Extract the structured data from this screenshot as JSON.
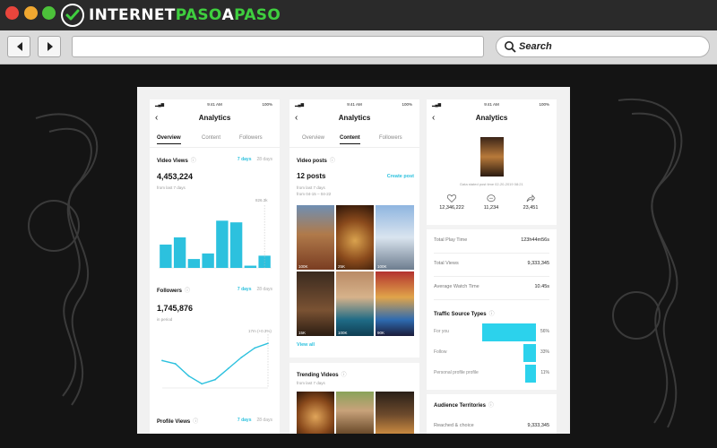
{
  "browser": {
    "brand_part1": "INTERNET",
    "brand_part2": "PASO",
    "brand_part3": "A",
    "brand_part4": "PASO",
    "search_placeholder": "Search",
    "colors": {
      "brand_green": "#3fcf3f",
      "chrome": "#2a2a2a",
      "accent_cyan": "#2cc1de"
    }
  },
  "status_bar": {
    "time": "9:41 AM",
    "battery": "100%"
  },
  "panel1": {
    "title": "Analytics",
    "tabs": [
      "Overview",
      "Content",
      "Followers"
    ],
    "video_views": {
      "label": "Video Views",
      "range_selected": "7 days",
      "range_other": "28 days",
      "total": "4,453,224",
      "subtext": "from last 7 days",
      "peak_label": "826.3k"
    },
    "followers": {
      "label": "Followers",
      "range_selected": "7 days",
      "range_other": "28 days",
      "total": "1,745,876",
      "subtext": "in period",
      "peak_label": "17m (+0.3%)"
    },
    "profile_views": {
      "label": "Profile Views",
      "range_selected": "7 days",
      "range_other": "28 days"
    }
  },
  "panel2": {
    "title": "Analytics",
    "tabs": [
      "Overview",
      "Content",
      "Followers"
    ],
    "video_posts_label": "Video posts",
    "posts_count": "12 posts",
    "create_post": "Create post",
    "posts_sub": "from last 7 days",
    "posts_range": "from 04-15 – 04-22",
    "thumb_views": [
      "100K",
      "25K",
      "100K",
      "15K",
      "100K",
      "90K"
    ],
    "view_all": "View all",
    "trending_label": "Trending Videos",
    "trending_sub": "from last 7 days"
  },
  "panel3": {
    "title": "Analytics",
    "posted_text": "Data stated post time 02-20-2019 08:21",
    "stats": [
      {
        "icon": "heart-icon",
        "value": "12,346,222"
      },
      {
        "icon": "comment-icon",
        "value": "11,234"
      },
      {
        "icon": "share-icon",
        "value": "23,451"
      }
    ],
    "metrics": [
      {
        "key": "Total Play Time",
        "value": "123h44m56s"
      },
      {
        "key": "Total Views",
        "value": "9,333,345"
      },
      {
        "key": "Average Watch Time",
        "value": "10.45s"
      }
    ],
    "traffic_label": "Traffic Source Types",
    "traffic": [
      {
        "key": "For you",
        "pct": "56%"
      },
      {
        "key": "Follow",
        "pct": "33%"
      },
      {
        "key": "Personal profile profile",
        "pct": "11%"
      }
    ],
    "territories_label": "Audience Territories",
    "territory_row": {
      "key": "Reached & choice",
      "value": "9,333,345"
    }
  },
  "chart_data": [
    {
      "type": "bar",
      "title": "Video Views",
      "categories": [
        "",
        "",
        "",
        "",
        "",
        "",
        ""
      ],
      "values": [
        0.42,
        0.55,
        0.16,
        0.26,
        0.85,
        0.82,
        0.04,
        0.22
      ],
      "ylim": [
        0,
        1
      ]
    },
    {
      "type": "line",
      "title": "Followers",
      "x": [
        0,
        1,
        2,
        3,
        4,
        5,
        6,
        7,
        8
      ],
      "values": [
        0.55,
        0.48,
        0.22,
        0.05,
        0.14,
        0.38,
        0.62,
        0.82,
        0.92
      ],
      "ylim": [
        0,
        1
      ]
    }
  ]
}
